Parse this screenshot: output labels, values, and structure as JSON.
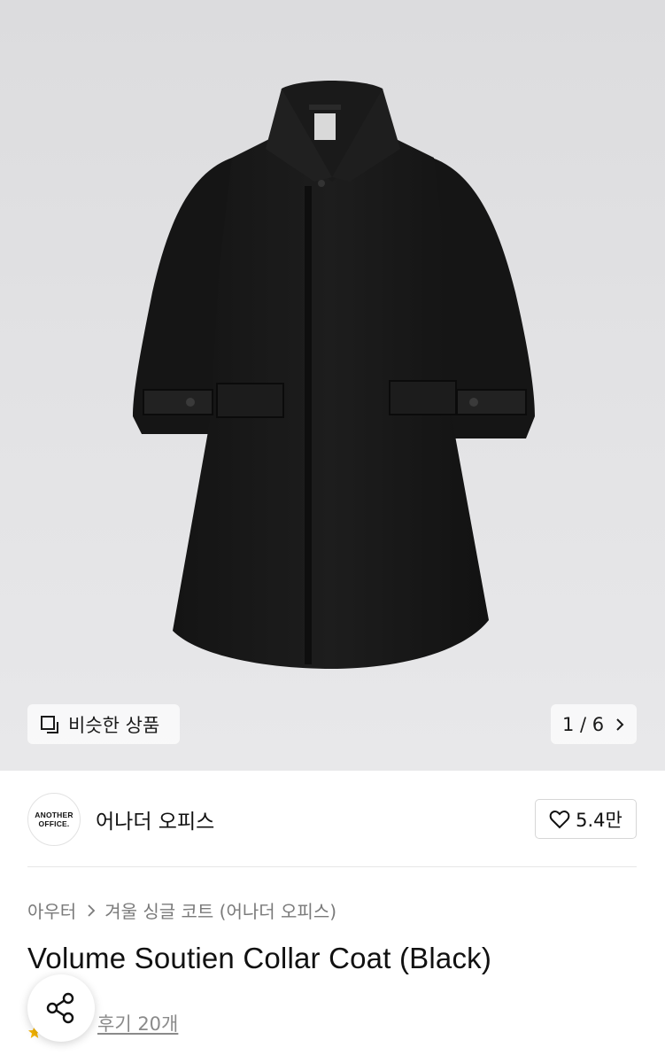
{
  "gallery": {
    "similar_label": "비슷한 상품",
    "pager": "1 / 6"
  },
  "brand": {
    "logo_text": [
      "ANOTHER",
      "OFFICE."
    ],
    "name": "어나더 오피스",
    "like_count": "5.4만"
  },
  "breadcrumb": {
    "category": "아우터",
    "subcategory": "겨울 싱글 코트 (어나더 오피스)"
  },
  "product": {
    "title": "Volume Soutien Collar Coat (Black)",
    "review_text": "후기 20개"
  },
  "colors": {
    "rating_star": "#f5b400"
  }
}
